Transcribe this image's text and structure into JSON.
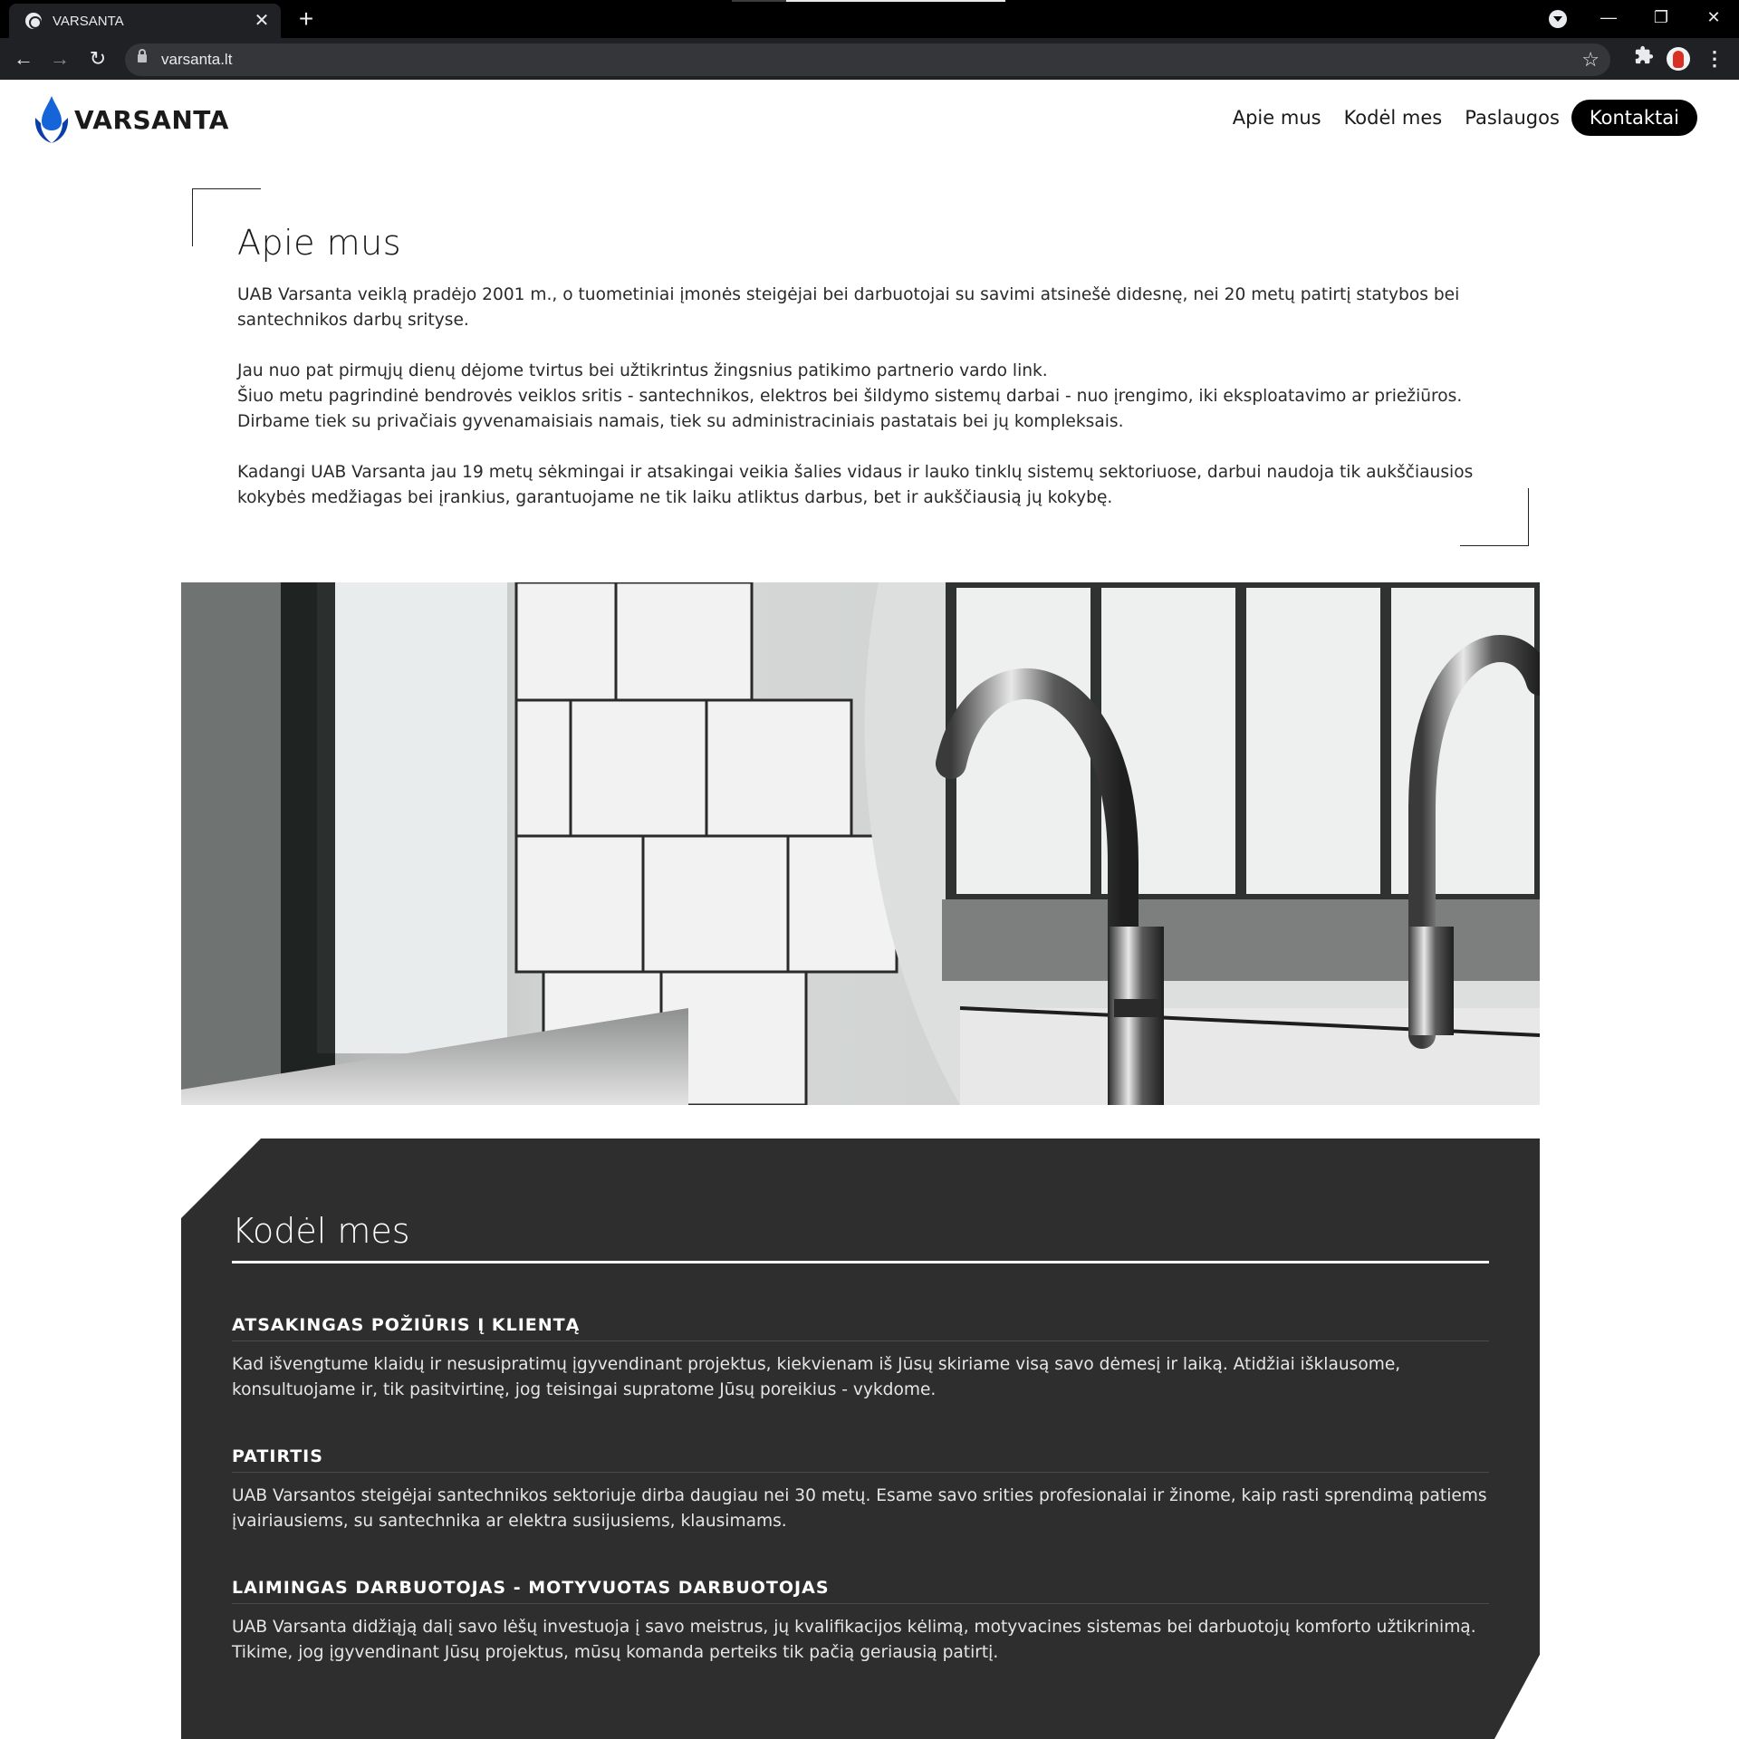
{
  "browser": {
    "tab_title": "VARSANTA",
    "tab_close": "✕",
    "new_tab": "+",
    "url": "varsanta.lt",
    "back": "←",
    "forward": "→",
    "reload": "↻",
    "star": "☆",
    "extensions": "🧩",
    "menu": "⋮",
    "minimize": "—",
    "restore": "❐",
    "close": "✕"
  },
  "header": {
    "logo_text": "VARSANTA",
    "logo_colors": [
      "#1565d8",
      "#0a3fa8"
    ],
    "nav": [
      {
        "label": "Apie mus"
      },
      {
        "label": "Kodėl mes"
      },
      {
        "label": "Paslaugos"
      }
    ],
    "cta": "Kontaktai"
  },
  "about": {
    "title": "Apie mus",
    "p1": "UAB Varsanta veiklą pradėjo 2001 m., o tuometiniai įmonės steigėjai bei darbuotojai su savimi atsinešė didesnę, nei 20 metų patirtį statybos bei santechnikos darbų srityse.",
    "p2a": "Jau nuo pat pirmųjų dienų dėjome tvirtus bei užtikrintus žingsnius patikimo partnerio vardo link.",
    "p2b": "Šiuo metu pagrindinė bendrovės veiklos sritis - santechnikos, elektros bei šildymo sistemų darbai - nuo įrengimo, iki eksploatavimo ar priežiūros. Dirbame tiek su privačiais gyvenamaisiais namais, tiek su administraciniais pastatais bei jų kompleksais.",
    "p3": "Kadangi UAB Varsanta jau 19 metų sėkmingai ir atsakingai veikia šalies vidaus ir lauko tinklų sistemų sektoriuose, darbui naudoja tik aukščiausios kokybės medžiagas bei įrankius, garantuojame ne tik laiku atliktus darbus, bet ir aukščiausią jų kokybę."
  },
  "why": {
    "title": "Kodėl mes",
    "items": [
      {
        "title": "ATSAKINGAS POŽIŪRIS Į KLIENTĄ",
        "text": "Kad išvengtume klaidų ir nesusipratimų įgyvendinant projektus, kiekvienam iš Jūsų skiriame visą savo dėmesį ir laiką. Atidžiai išklausome, konsultuojame ir, tik pasitvirtinę, jog teisingai supratome Jūsų poreikius - vykdome."
      },
      {
        "title": "PATIRTIS",
        "text": "UAB Varsantos steigėjai santechnikos sektoriuje dirba daugiau nei 30 metų. Esame savo srities profesionalai ir žinome, kaip rasti sprendimą patiems įvairiausiems, su santechnika ar elektra susijusiems, klausimams."
      },
      {
        "title": "LAIMINGAS DARBUOTOJAS - MOTYVUOTAS DARBUOTOJAS",
        "text": "UAB Varsanta didžiąją dalį savo lėšų investuoja į savo meistrus, jų kvalifikacijos kėlimą, motyvacines sistemas bei darbuotojų komforto užtikrinimą. Tikime, jog įgyvendinant Jūsų projektus, mūsų komanda perteiks tik pačią geriausią patirtį."
      }
    ]
  }
}
